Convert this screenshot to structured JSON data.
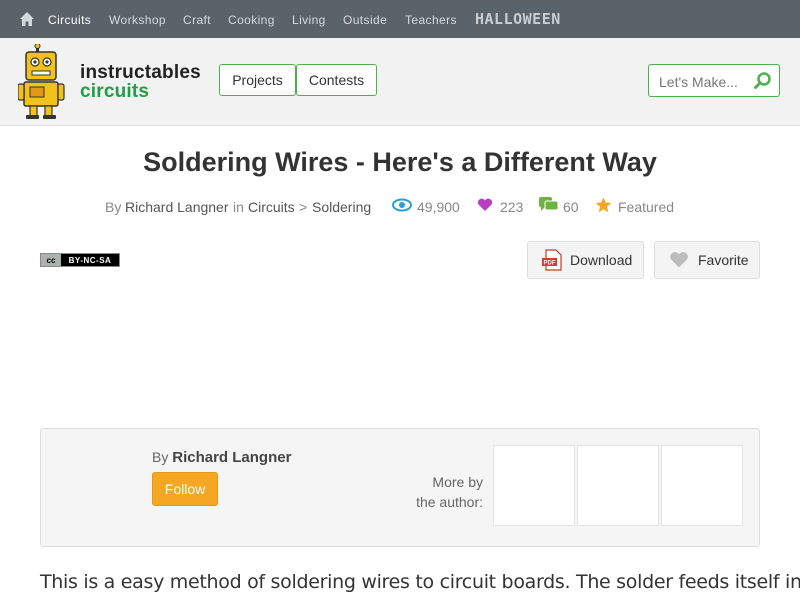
{
  "topnav": {
    "items": [
      {
        "label": "Circuits",
        "active": true
      },
      {
        "label": "Workshop"
      },
      {
        "label": "Craft"
      },
      {
        "label": "Cooking"
      },
      {
        "label": "Living"
      },
      {
        "label": "Outside"
      },
      {
        "label": "Teachers"
      }
    ],
    "promo": "HALLOWEEN"
  },
  "header": {
    "logo_line1": "instructables",
    "logo_line2": "circuits",
    "projects_label": "Projects",
    "contests_label": "Contests",
    "search_placeholder": "Let's Make...",
    "accent": "#4cb04f"
  },
  "article": {
    "title": "Soldering Wires - Here's a Different Way",
    "by_prefix": "By",
    "author": "Richard Langner",
    "in_word": "in",
    "category": "Circuits",
    "separator": ">",
    "subcategory": "Soldering",
    "views": "49,900",
    "favorites": "223",
    "comments": "60",
    "featured": "Featured",
    "license_cc": "cc",
    "license_text": "BY-NC-SA",
    "download_label": "Download",
    "favorite_label": "Favorite",
    "intro": "This is a easy method of soldering wires to circuit boards. The solder feeds itself into"
  },
  "author_box": {
    "by_prefix": "By",
    "author": "Richard Langner",
    "follow_label": "Follow",
    "more_line1": "More by",
    "more_line2": "the author:"
  }
}
